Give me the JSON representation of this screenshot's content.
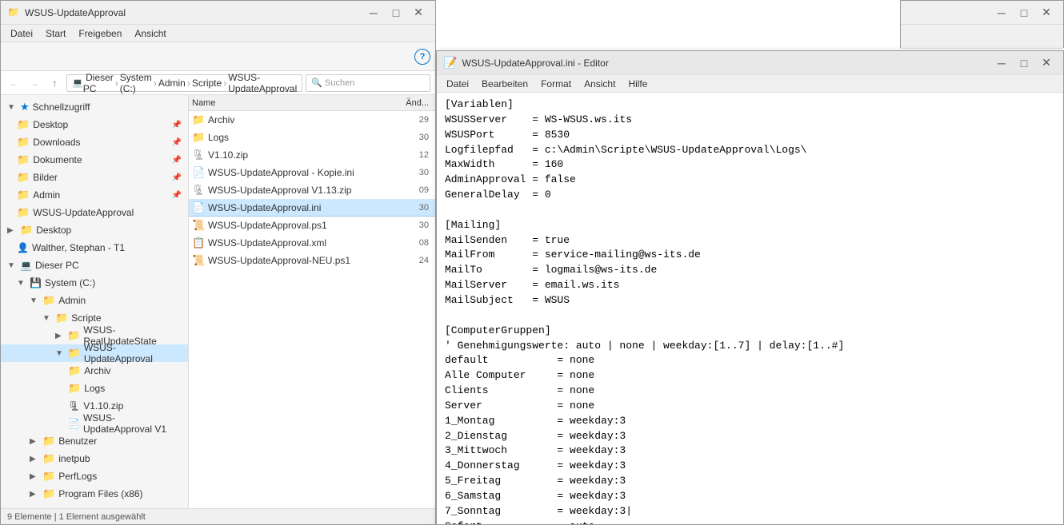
{
  "explorer": {
    "title": "WSUS-UpdateApproval",
    "menu": [
      "Datei",
      "Start",
      "Freigeben",
      "Ansicht"
    ],
    "nav": {
      "back_label": "←",
      "forward_label": "→",
      "up_label": "↑",
      "path_segments": [
        "Dieser PC",
        "System (C:)",
        "Admin",
        "Scripte",
        "WSUS-UpdateApproval"
      ]
    },
    "sidebar": [
      {
        "label": "Schnellzugriff",
        "indent": 0,
        "icon": "star",
        "expanded": true
      },
      {
        "label": "Desktop",
        "indent": 1,
        "icon": "folder-blue",
        "pinned": true
      },
      {
        "label": "Downloads",
        "indent": 1,
        "icon": "folder-blue",
        "pinned": true
      },
      {
        "label": "Dokumente",
        "indent": 1,
        "icon": "folder-blue",
        "pinned": true
      },
      {
        "label": "Bilder",
        "indent": 1,
        "icon": "folder",
        "pinned": true
      },
      {
        "label": "Admin",
        "indent": 1,
        "icon": "folder",
        "pinned": true
      },
      {
        "label": "WSUS-UpdateApproval",
        "indent": 1,
        "icon": "folder"
      },
      {
        "label": "Desktop",
        "indent": 0,
        "icon": "folder"
      },
      {
        "label": "Walther, Stephan - T1",
        "indent": 1,
        "icon": "person"
      },
      {
        "label": "Dieser PC",
        "indent": 0,
        "icon": "computer",
        "expanded": true
      },
      {
        "label": "System (C:)",
        "indent": 1,
        "icon": "drive",
        "expanded": true
      },
      {
        "label": "Admin",
        "indent": 2,
        "icon": "folder",
        "expanded": true
      },
      {
        "label": "Scripte",
        "indent": 3,
        "icon": "folder",
        "expanded": true
      },
      {
        "label": "WSUS-RealUpdateState",
        "indent": 4,
        "icon": "folder"
      },
      {
        "label": "WSUS-UpdateApproval",
        "indent": 4,
        "icon": "folder",
        "selected": true,
        "expanded": true
      },
      {
        "label": "Archiv",
        "indent": 5,
        "icon": "folder"
      },
      {
        "label": "Logs",
        "indent": 5,
        "icon": "folder"
      },
      {
        "label": "V1.10.zip",
        "indent": 5,
        "icon": "zip"
      },
      {
        "label": "WSUS-UpdateApproval V1",
        "indent": 5,
        "icon": "ini"
      },
      {
        "label": "Benutzer",
        "indent": 2,
        "icon": "folder"
      },
      {
        "label": "inetpub",
        "indent": 2,
        "icon": "folder"
      },
      {
        "label": "PerfLogs",
        "indent": 2,
        "icon": "folder"
      },
      {
        "label": "Program Files (x86)",
        "indent": 2,
        "icon": "folder"
      }
    ],
    "files": {
      "header": {
        "name": "Name",
        "date": "Änd..."
      },
      "items": [
        {
          "name": "Archiv",
          "icon": "folder",
          "date": "29"
        },
        {
          "name": "Logs",
          "icon": "folder",
          "date": "30"
        },
        {
          "name": "V1.10.zip",
          "icon": "zip",
          "date": "12"
        },
        {
          "name": "WSUS-UpdateApproval - Kopie.ini",
          "icon": "ini",
          "date": "30"
        },
        {
          "name": "WSUS-UpdateApproval V1.13.zip",
          "icon": "zip",
          "date": "09"
        },
        {
          "name": "WSUS-UpdateApproval.ini",
          "icon": "ini",
          "date": "30",
          "selected": true
        },
        {
          "name": "WSUS-UpdateApproval.ps1",
          "icon": "ps1",
          "date": "30"
        },
        {
          "name": "WSUS-UpdateApproval.xml",
          "icon": "xml",
          "date": "08"
        },
        {
          "name": "WSUS-UpdateApproval-NEU.ps1",
          "icon": "ps1",
          "date": "24"
        }
      ]
    }
  },
  "notepad": {
    "title": "WSUS-UpdateApproval.ini - Editor",
    "menu": [
      "Datei",
      "Bearbeiten",
      "Format",
      "Ansicht",
      "Hilfe"
    ],
    "content": "[Variablen]\nWSUSServer    = WS-WSUS.ws.its\nWSUSPort      = 8530\nLogfilepfad   = c:\\Admin\\Scripte\\WSUS-UpdateApproval\\Logs\\\nMaxWidth      = 160\nAdminApproval = false\nGeneralDelay  = 0\n\n[Mailing]\nMailSenden    = true\nMailFrom      = service-mailing@ws-its.de\nMailTo        = logmails@ws-its.de\nMailServer    = email.ws.its\nMailSubject   = WSUS\n\n[ComputerGruppen]\n' Genehmigungswerte: auto | none | weekday:[1..7] | delay:[1..#]\ndefault           = none\nAlle Computer     = none\nClients           = none\nServer            = none\n1_Montag          = weekday:3\n2_Dienstag        = weekday:3\n3_Mittwoch        = weekday:3\n4_Donnerstag      = weekday:3\n5_Freitag         = weekday:3\n6_Samstag         = weekday:3\n7_Sonntag         = weekday:3|\nSofort            = auto\n\n[Pl...]",
    "controls": {
      "minimize": "─",
      "maximize": "□",
      "close": "✕"
    }
  },
  "second_explorer": {
    "title": "",
    "controls": {
      "minimize": "─",
      "maximize": "□",
      "close": "✕"
    }
  }
}
